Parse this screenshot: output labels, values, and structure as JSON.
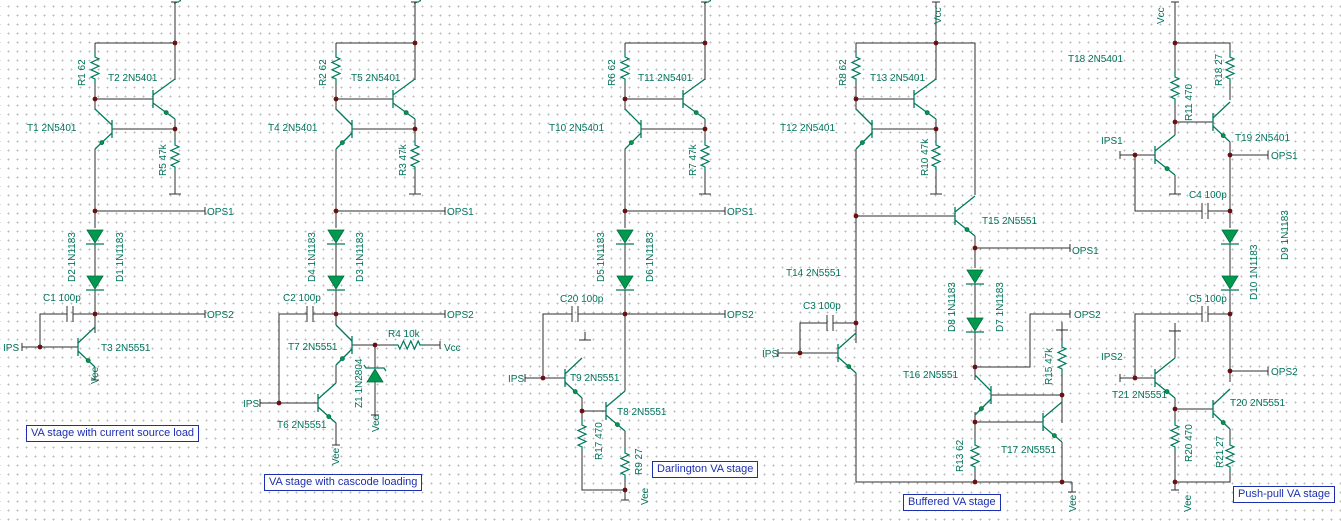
{
  "captions": [
    "VA stage with current source load",
    "VA stage with cascode loading",
    "Darlington VA stage",
    "Buffered VA stage",
    "Push-pull VA stage"
  ],
  "labels": {
    "vcc": "Vcc",
    "vee": "Vee",
    "ips": "IPS",
    "ips1": "IPS1",
    "ips2": "IPS2",
    "ops1": "OPS1",
    "ops2": "OPS2",
    "c1": "C1 100p",
    "c2": "C2 100p",
    "c3": "C3 100p",
    "c4": "C4 100p",
    "c5": "C5 100p",
    "c20": "C20 100p",
    "d1": "D1 1N1183",
    "d2": "D2 1N1183",
    "d3": "D3 1N1183",
    "d4": "D4 1N1183",
    "d5": "D5 1N1183",
    "d6": "D6 1N1183",
    "d7": "D7 1N1183",
    "d8": "D8 1N1183",
    "d9": "D9 1N1183",
    "d10": "D10 1N1183",
    "r1": "R1 62",
    "r2": "R2 62",
    "r3": "R3 47k",
    "r4": "R4 10k",
    "r5": "R5 47k",
    "r6": "R6 62",
    "r7": "R7 47k",
    "r8": "R8 62",
    "r9": "R9 27",
    "r10": "R10 47k",
    "r11": "R11 470",
    "r13": "R13 62",
    "r15": "R15 47k",
    "r17": "R17 470",
    "r18": "R18 27",
    "r20": "R20 470",
    "r21": "R21 27",
    "t1": "T1 2N5401",
    "t2": "T2 2N5401",
    "t3": "T3 2N5551",
    "t4": "T4 2N5401",
    "t5": "T5 2N5401",
    "t6": "T6 2N5551",
    "t7": "T7 2N5551",
    "t8": "T8 2N5551",
    "t9": "T9 2N5551",
    "t10": "T10 2N5401",
    "t11": "T11 2N5401",
    "t12": "T12 2N5401",
    "t13": "T13 2N5401",
    "t14": "T14 2N5551",
    "t15": "T15 2N5551",
    "t16": "T16 2N5551",
    "t17": "T17 2N5551",
    "t18": "T18 2N5401",
    "t19": "T19 2N5401",
    "t20": "T20 2N5551",
    "t21": "T21 2N5551",
    "z1": "Z1 1N2804"
  },
  "colors": {
    "wire": "#2f2f2f",
    "component": "#007a5e",
    "diode_fill": "#009a4e",
    "junction": "#6a1010",
    "label": "#00735c",
    "caption": "#1c2fb0",
    "grid_dot": "#b9b9b9"
  }
}
